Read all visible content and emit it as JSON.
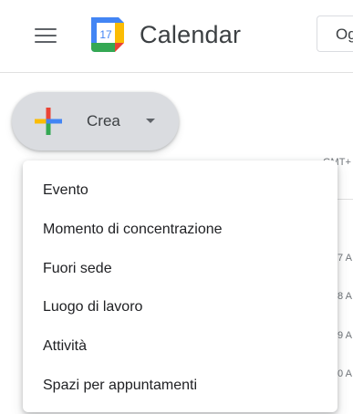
{
  "header": {
    "app_title": "Calendar",
    "logo_day": "17",
    "today_label": "Og",
    "menu_icon": "hamburger-menu-icon"
  },
  "create": {
    "label": "Crea",
    "icon": "plus-icon",
    "caret_icon": "caret-down-icon"
  },
  "calendar_bg": {
    "timezone_label": "GMT+",
    "time_labels": [
      "7 A",
      "8 A",
      "9 A",
      "0 A"
    ]
  },
  "dropdown": {
    "items": [
      {
        "label": "Evento"
      },
      {
        "label": "Momento di concentrazione"
      },
      {
        "label": "Fuori sede"
      },
      {
        "label": "Luogo di lavoro"
      },
      {
        "label": "Attività"
      },
      {
        "label": "Spazi per appuntamenti"
      }
    ]
  },
  "colors": {
    "blue": "#4285f4",
    "red": "#ea4335",
    "yellow": "#fbbc04",
    "green": "#34a853",
    "create_bg": "#dadce0"
  }
}
